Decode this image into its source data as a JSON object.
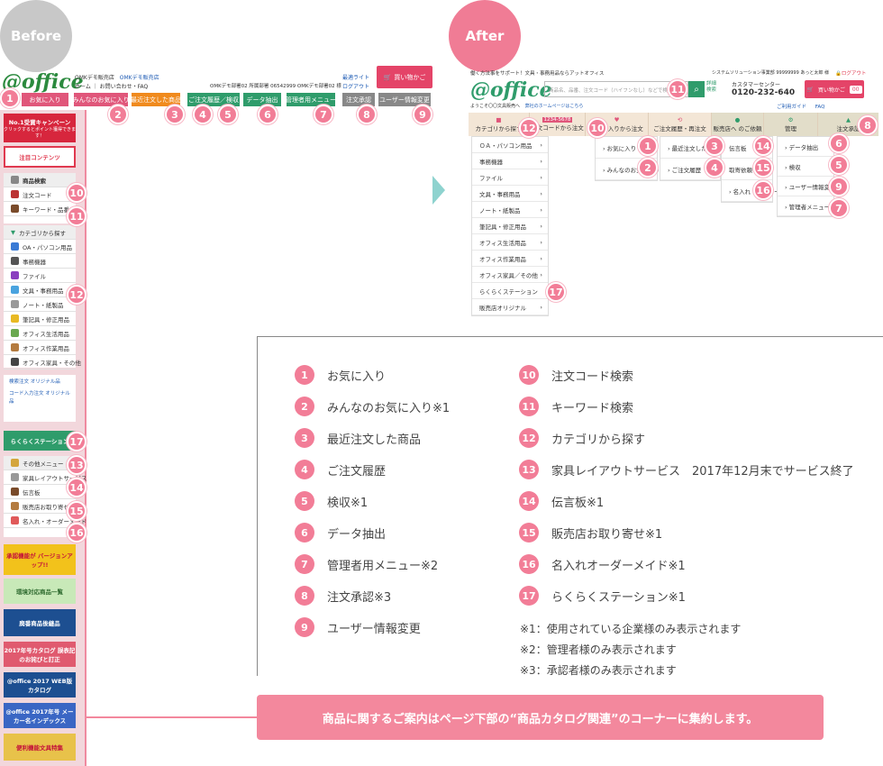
{
  "tags": {
    "before": "Before",
    "after": "After"
  },
  "before": {
    "logo": "@office",
    "header_line1": "OMKデモ販売店",
    "header_link1": "OMKデモ販売店",
    "header_line2": "ホーム ｜ お問い合わせ・FAQ",
    "account": "OMKデモ部署02 所属部署 06542999 OMKデモ部署02 様",
    "welcome_title": "最適ライト",
    "logout": "ログアウト",
    "cart_label": "買い物かご",
    "nav": [
      {
        "label": "お気に入り",
        "color": "#e0567a"
      },
      {
        "label": "みんなのお気に入り",
        "color": "#e0567a"
      },
      {
        "label": "最近注文した商品",
        "color": "#f08a1d"
      },
      {
        "label": "ご注文履歴／検収",
        "color": "#2f9c6b"
      },
      {
        "label": "データ抽出",
        "color": "#2f9c6b"
      },
      {
        "label": "管理者用メニュー",
        "color": "#2f9c6b"
      },
      {
        "label": "注文承認",
        "color": "#888888"
      },
      {
        "label": "ユーザー情報変更",
        "color": "#888888"
      }
    ],
    "side": {
      "campaign": "No.1受賞キャンペーン",
      "campaign_sub": "クリックするとポイント獲得できます！",
      "attention": "注目コンテンツ",
      "search_title": "商品検索",
      "order_code": "注文コード",
      "keyword": "キーワード・品番",
      "category_title": "カテゴリから探す",
      "categories": [
        "OA・パソコン用品",
        "事務機器",
        "ファイル",
        "文具・事務用品",
        "ノート・紙製品",
        "筆記具・修正用品",
        "オフィス生活用品",
        "オフィス作業用品",
        "オフィス家具・その他"
      ],
      "original1": "検索注文 オリジナル品",
      "original2": "コード入力注文 オリジナル品",
      "station": "らくらくステーション",
      "other_menu": "その他メニュー",
      "layout_service": "家具レイアウトサービス",
      "board": "伝言板",
      "dealer": "販売店お取り寄せ",
      "name_order": "名入れ・オーダーメード",
      "approval_banner": "承認機能が バージョンアップ!!",
      "eco": "環境対応商品一覧",
      "discontinued": "廃番商品後継品",
      "catalog2017": "2017年号カタログ 誤表記のお詫びと訂正",
      "webcat": "@office 2017 WEB版 カタログ",
      "maker": "@office 2017年号 メーカー名インデックス",
      "stationery": "便利機能文具特集"
    }
  },
  "after": {
    "tagline": "働く方法事をサポート！文具・事務用品ならアットオフィス",
    "logo": "@office",
    "search_placeholder": "商品名、品番、注文コード（ハイフンなし）などで検索",
    "detail_search": "詳細 検索",
    "system_line": "システムソリューション事業部 99999999 あっと太郎 様",
    "logout": "ログアウト",
    "customer_center": "カスタマーセンター",
    "phone": "0120-232-640",
    "cart": "買い物かご",
    "cart_count": "00",
    "welcome": "ようこそ〇〇文具販売へ",
    "shop_home": "弊社のホームページはこちら",
    "guide": "ご利用ガイド",
    "faq": "FAQ",
    "nav": [
      {
        "label": "カテゴリから探す"
      },
      {
        "label": "注文コードから注文",
        "badge": "1234-5678"
      },
      {
        "label": "お気に入りから注文"
      },
      {
        "label": "ご注文履歴・再注文"
      },
      {
        "label": "販売店へ のご依頼"
      },
      {
        "label": "管理"
      },
      {
        "label": "注文承認"
      }
    ],
    "categories": [
      "ＯＡ・パソコン用品",
      "事務機器",
      "ファイル",
      "文具・事務用品",
      "ノート・紙製品",
      "筆記具・修正用品",
      "オフィス生活用品",
      "オフィス作業用品",
      "オフィス家具／その他",
      "らくらくステーション",
      "販売店オリジナル"
    ],
    "fav_menu": [
      "お気に入り",
      "みんなのお気に入り"
    ],
    "history_menu": [
      "最近注文した商品",
      "ご注文履歴"
    ],
    "dealer_menu": [
      "伝言板",
      "取寄依頼",
      "名入れ・オーダー"
    ],
    "admin_menu": [
      "データ抽出",
      "検収",
      "ユーザー情報変更",
      "管理者メニュー"
    ]
  },
  "legend": {
    "left": [
      {
        "n": "1",
        "text": "お気に入り"
      },
      {
        "n": "2",
        "text": "みんなのお気に入り※1"
      },
      {
        "n": "3",
        "text": "最近注文した商品"
      },
      {
        "n": "4",
        "text": "ご注文履歴"
      },
      {
        "n": "5",
        "text": "検収※1"
      },
      {
        "n": "6",
        "text": "データ抽出"
      },
      {
        "n": "7",
        "text": "管理者用メニュー※2"
      },
      {
        "n": "8",
        "text": "注文承認※3"
      },
      {
        "n": "9",
        "text": "ユーザー情報変更"
      }
    ],
    "right": [
      {
        "n": "10",
        "text": "注文コード検索"
      },
      {
        "n": "11",
        "text": "キーワード検索"
      },
      {
        "n": "12",
        "text": "カテゴリから探す"
      },
      {
        "n": "13",
        "text": "家具レイアウトサービス　2017年12月末でサービス終了"
      },
      {
        "n": "14",
        "text": "伝言板※1"
      },
      {
        "n": "15",
        "text": "販売店お取り寄せ※1"
      },
      {
        "n": "16",
        "text": "名入れオーダーメイド※1"
      },
      {
        "n": "17",
        "text": "らくらくステーション※1"
      }
    ],
    "notes": [
      "※1：使用されている企業様のみ表示されます",
      "※2：管理者様のみ表示されます",
      "※3：承認者様のみ表示されます"
    ]
  },
  "cta": "商品に関するご案内はページ下部の“商品カタログ関連”のコーナーに集約します。",
  "colors": {
    "accent_pink": "#f27d97",
    "arrow": "#8ed3cf",
    "green": "#2f9c6b"
  }
}
